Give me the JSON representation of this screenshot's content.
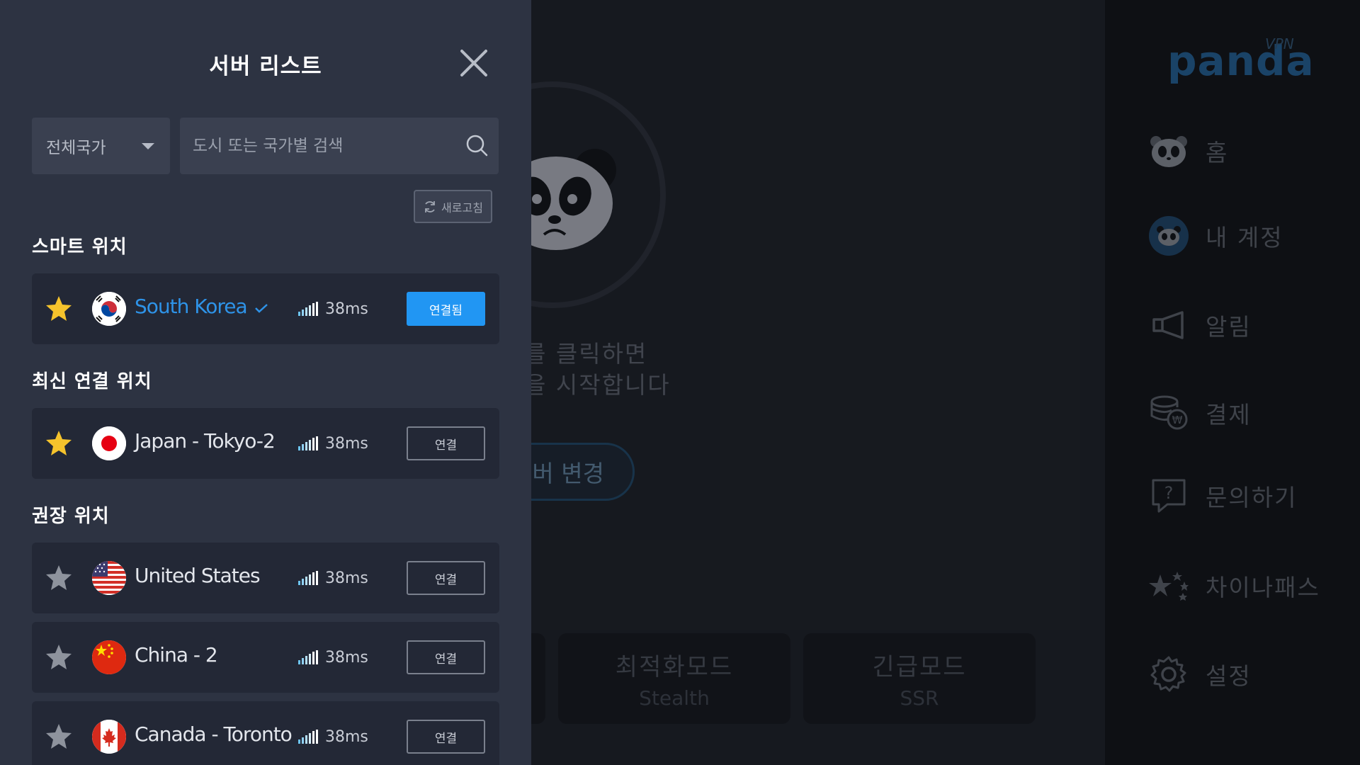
{
  "colors": {
    "accent": "#2196f3",
    "star_active": "#f5c32c",
    "star_inactive": "#8e939d",
    "drawer_bg": "#2d3342",
    "row_bg": "#232836"
  },
  "drawer": {
    "title": "서버 리스트",
    "close_icon": "close-icon",
    "country_select": {
      "value": "전체국가"
    },
    "search": {
      "placeholder": "도시 또는 국가별 검색",
      "icon": "search-icon"
    },
    "refresh_label": "새로고침",
    "sections": {
      "smart": {
        "title": "스마트 위치",
        "servers": [
          {
            "name": "South Korea",
            "ping": "38ms",
            "button": "연결됨",
            "favorite": true,
            "connected": true,
            "flag": "south-korea-flag"
          }
        ]
      },
      "recent": {
        "title": "최신 연결 위치",
        "servers": [
          {
            "name": "Japan - Tokyo-2",
            "ping": "38ms",
            "button": "연결",
            "favorite": true,
            "connected": false,
            "flag": "japan-flag"
          }
        ]
      },
      "recommend": {
        "title": "권장 위치",
        "servers": [
          {
            "name": "United States",
            "ping": "38ms",
            "button": "연결",
            "favorite": false,
            "connected": false,
            "flag": "usa-flag"
          },
          {
            "name": "China - 2",
            "ping": "38ms",
            "button": "연결",
            "favorite": false,
            "connected": false,
            "flag": "china-flag"
          },
          {
            "name": "Canada - Toronto",
            "ping": "38ms",
            "button": "연결",
            "favorite": false,
            "connected": false,
            "flag": "canada-flag"
          }
        ]
      }
    }
  },
  "main": {
    "desc_line1": "를 클릭하면",
    "desc_line2": "을 시작합니다",
    "change_server_label": "서버 변경",
    "modes": [
      {
        "title": "",
        "sub": ""
      },
      {
        "title": "최적화모드",
        "sub": "Stealth"
      },
      {
        "title": "긴급모드",
        "sub": "SSR"
      }
    ]
  },
  "sidebar": {
    "logo_text": "panda",
    "logo_vpn": "VPN",
    "items": [
      {
        "label": "홈",
        "icon": "panda-face-icon"
      },
      {
        "label": "내 계정",
        "icon": "account-avatar-icon"
      },
      {
        "label": "알림",
        "icon": "megaphone-icon"
      },
      {
        "label": "결제",
        "icon": "coins-icon"
      },
      {
        "label": "문의하기",
        "icon": "question-bubble-icon"
      },
      {
        "label": "차이나패스",
        "icon": "china-stars-icon"
      },
      {
        "label": "설정",
        "icon": "gear-icon"
      }
    ]
  }
}
